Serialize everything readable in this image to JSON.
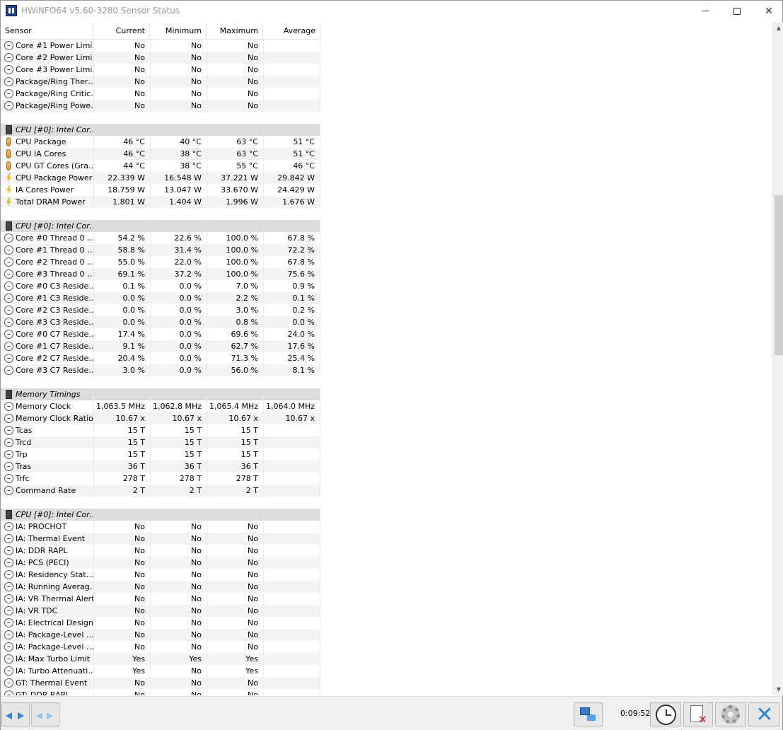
{
  "window": {
    "title": "HWiNFO64 v5.60-3280 Sensor Status"
  },
  "columns": {
    "sensor": "Sensor",
    "current": "Current",
    "minimum": "Minimum",
    "maximum": "Maximum",
    "average": "Average"
  },
  "rows": [
    {
      "type": "item",
      "icon": "clock-icon",
      "name": "Core #1 Power Limi…",
      "cur": "No",
      "min": "No",
      "max": "No",
      "avg": ""
    },
    {
      "type": "item",
      "icon": "clock-icon",
      "name": "Core #2 Power Limi…",
      "cur": "No",
      "min": "No",
      "max": "No",
      "avg": ""
    },
    {
      "type": "item",
      "icon": "clock-icon",
      "name": "Core #3 Power Limi…",
      "cur": "No",
      "min": "No",
      "max": "No",
      "avg": ""
    },
    {
      "type": "item",
      "icon": "clock-icon",
      "name": "Package/Ring Ther…",
      "cur": "No",
      "min": "No",
      "max": "No",
      "avg": ""
    },
    {
      "type": "item",
      "icon": "clock-icon",
      "name": "Package/Ring Critic…",
      "cur": "No",
      "min": "No",
      "max": "No",
      "avg": ""
    },
    {
      "type": "item",
      "icon": "clock-icon",
      "name": "Package/Ring Powe…",
      "cur": "No",
      "min": "No",
      "max": "No",
      "avg": ""
    },
    {
      "type": "blank"
    },
    {
      "type": "group",
      "icon": "chip-icon",
      "name": "CPU [#0]: Intel Cor…"
    },
    {
      "type": "item",
      "icon": "thermometer-icon",
      "name": "CPU Package",
      "cur": "46 °C",
      "min": "40 °C",
      "max": "63 °C",
      "avg": "51 °C"
    },
    {
      "type": "item",
      "icon": "thermometer-icon",
      "name": "CPU IA Cores",
      "cur": "46 °C",
      "min": "38 °C",
      "max": "63 °C",
      "avg": "51 °C"
    },
    {
      "type": "item",
      "icon": "thermometer-icon",
      "name": "CPU GT Cores (Gra…",
      "cur": "44 °C",
      "min": "38 °C",
      "max": "55 °C",
      "avg": "46 °C"
    },
    {
      "type": "item",
      "icon": "lightning-icon",
      "name": "CPU Package Power",
      "cur": "22.339 W",
      "min": "16.548 W",
      "max": "37.221 W",
      "avg": "29.842 W"
    },
    {
      "type": "item",
      "icon": "lightning-icon",
      "name": "IA Cores Power",
      "cur": "18.759 W",
      "min": "13.047 W",
      "max": "33.670 W",
      "avg": "24.429 W"
    },
    {
      "type": "item",
      "icon": "lightning-icon",
      "name": "Total DRAM Power",
      "cur": "1.801 W",
      "min": "1.404 W",
      "max": "1.996 W",
      "avg": "1.676 W"
    },
    {
      "type": "blank"
    },
    {
      "type": "group",
      "icon": "chip-icon",
      "name": "CPU [#0]: Intel Cor…"
    },
    {
      "type": "item",
      "icon": "clock-icon",
      "name": "Core #0 Thread 0 …",
      "cur": "54.2 %",
      "min": "22.6 %",
      "max": "100.0 %",
      "avg": "67.8 %"
    },
    {
      "type": "item",
      "icon": "clock-icon",
      "name": "Core #1 Thread 0 …",
      "cur": "58.8 %",
      "min": "31.4 %",
      "max": "100.0 %",
      "avg": "72.2 %"
    },
    {
      "type": "item",
      "icon": "clock-icon",
      "name": "Core #2 Thread 0 …",
      "cur": "55.0 %",
      "min": "22.0 %",
      "max": "100.0 %",
      "avg": "67.8 %"
    },
    {
      "type": "item",
      "icon": "clock-icon",
      "name": "Core #3 Thread 0 …",
      "cur": "69.1 %",
      "min": "37.2 %",
      "max": "100.0 %",
      "avg": "75.6 %"
    },
    {
      "type": "item",
      "icon": "clock-icon",
      "name": "Core #0 C3 Reside…",
      "cur": "0.1 %",
      "min": "0.0 %",
      "max": "7.0 %",
      "avg": "0.9 %"
    },
    {
      "type": "item",
      "icon": "clock-icon",
      "name": "Core #1 C3 Reside…",
      "cur": "0.0 %",
      "min": "0.0 %",
      "max": "2.2 %",
      "avg": "0.1 %"
    },
    {
      "type": "item",
      "icon": "clock-icon",
      "name": "Core #2 C3 Reside…",
      "cur": "0.0 %",
      "min": "0.0 %",
      "max": "3.0 %",
      "avg": "0.2 %"
    },
    {
      "type": "item",
      "icon": "clock-icon",
      "name": "Core #3 C3 Reside…",
      "cur": "0.0 %",
      "min": "0.0 %",
      "max": "0.8 %",
      "avg": "0.0 %"
    },
    {
      "type": "item",
      "icon": "clock-icon",
      "name": "Core #0 C7 Reside…",
      "cur": "17.4 %",
      "min": "0.0 %",
      "max": "69.6 %",
      "avg": "24.0 %"
    },
    {
      "type": "item",
      "icon": "clock-icon",
      "name": "Core #1 C7 Reside…",
      "cur": "9.1 %",
      "min": "0.0 %",
      "max": "62.7 %",
      "avg": "17.6 %"
    },
    {
      "type": "item",
      "icon": "clock-icon",
      "name": "Core #2 C7 Reside…",
      "cur": "20.4 %",
      "min": "0.0 %",
      "max": "71.3 %",
      "avg": "25.4 %"
    },
    {
      "type": "item",
      "icon": "clock-icon",
      "name": "Core #3 C7 Reside…",
      "cur": "3.0 %",
      "min": "0.0 %",
      "max": "56.0 %",
      "avg": "8.1 %"
    },
    {
      "type": "blank"
    },
    {
      "type": "group",
      "icon": "chip-icon",
      "name": "Memory Timings"
    },
    {
      "type": "item",
      "icon": "clock-icon",
      "name": "Memory Clock",
      "cur": "1,063.5 MHz",
      "min": "1,062.8 MHz",
      "max": "1,065.4 MHz",
      "avg": "1,064.0 MHz"
    },
    {
      "type": "item",
      "icon": "clock-icon",
      "name": "Memory Clock Ratio",
      "cur": "10.67 x",
      "min": "10.67 x",
      "max": "10.67 x",
      "avg": "10.67 x"
    },
    {
      "type": "item",
      "icon": "clock-icon",
      "name": "Tcas",
      "cur": "15 T",
      "min": "15 T",
      "max": "15 T",
      "avg": ""
    },
    {
      "type": "item",
      "icon": "clock-icon",
      "name": "Trcd",
      "cur": "15 T",
      "min": "15 T",
      "max": "15 T",
      "avg": ""
    },
    {
      "type": "item",
      "icon": "clock-icon",
      "name": "Trp",
      "cur": "15 T",
      "min": "15 T",
      "max": "15 T",
      "avg": ""
    },
    {
      "type": "item",
      "icon": "clock-icon",
      "name": "Tras",
      "cur": "36 T",
      "min": "36 T",
      "max": "36 T",
      "avg": ""
    },
    {
      "type": "item",
      "icon": "clock-icon",
      "name": "Trfc",
      "cur": "278 T",
      "min": "278 T",
      "max": "278 T",
      "avg": ""
    },
    {
      "type": "item",
      "icon": "clock-icon",
      "name": "Command Rate",
      "cur": "2 T",
      "min": "2 T",
      "max": "2 T",
      "avg": ""
    },
    {
      "type": "blank"
    },
    {
      "type": "group",
      "icon": "chip-icon",
      "name": "CPU [#0]: Intel Cor…"
    },
    {
      "type": "item",
      "icon": "clock-icon",
      "name": "IA: PROCHOT",
      "cur": "No",
      "min": "No",
      "max": "No",
      "avg": ""
    },
    {
      "type": "item",
      "icon": "clock-icon",
      "name": "IA: Thermal Event",
      "cur": "No",
      "min": "No",
      "max": "No",
      "avg": ""
    },
    {
      "type": "item",
      "icon": "clock-icon",
      "name": "IA: DDR RAPL",
      "cur": "No",
      "min": "No",
      "max": "No",
      "avg": ""
    },
    {
      "type": "item",
      "icon": "clock-icon",
      "name": "IA: PCS (PECI)",
      "cur": "No",
      "min": "No",
      "max": "No",
      "avg": ""
    },
    {
      "type": "item",
      "icon": "clock-icon",
      "name": "IA: Residency Stat…",
      "cur": "No",
      "min": "No",
      "max": "No",
      "avg": ""
    },
    {
      "type": "item",
      "icon": "clock-icon",
      "name": "IA: Running Averag…",
      "cur": "No",
      "min": "No",
      "max": "No",
      "avg": ""
    },
    {
      "type": "item",
      "icon": "clock-icon",
      "name": "IA: VR Thermal Alert",
      "cur": "No",
      "min": "No",
      "max": "No",
      "avg": ""
    },
    {
      "type": "item",
      "icon": "clock-icon",
      "name": "IA: VR TDC",
      "cur": "No",
      "min": "No",
      "max": "No",
      "avg": ""
    },
    {
      "type": "item",
      "icon": "clock-icon",
      "name": "IA: Electrical Design…",
      "cur": "No",
      "min": "No",
      "max": "No",
      "avg": ""
    },
    {
      "type": "item",
      "icon": "clock-icon",
      "name": "IA: Package-Level …",
      "cur": "No",
      "min": "No",
      "max": "No",
      "avg": ""
    },
    {
      "type": "item",
      "icon": "clock-icon",
      "name": "IA: Package-Level …",
      "cur": "No",
      "min": "No",
      "max": "No",
      "avg": ""
    },
    {
      "type": "item",
      "icon": "clock-icon",
      "name": "IA: Max Turbo Limit",
      "cur": "Yes",
      "min": "Yes",
      "max": "Yes",
      "avg": ""
    },
    {
      "type": "item",
      "icon": "clock-icon",
      "name": "IA: Turbo Attenuati…",
      "cur": "Yes",
      "min": "No",
      "max": "Yes",
      "avg": ""
    },
    {
      "type": "item",
      "icon": "clock-icon",
      "name": "GT: Thermal Event",
      "cur": "No",
      "min": "No",
      "max": "No",
      "avg": ""
    },
    {
      "type": "item",
      "icon": "clock-icon",
      "name": "GT: DDR RAPL",
      "cur": "No",
      "min": "No",
      "max": "No",
      "avg": ""
    }
  ],
  "status": {
    "elapsed": "0:09:52"
  },
  "icons": {
    "nav_left": "arrow-left-icon",
    "nav_right": "arrow-right-icon",
    "network": "network-icon",
    "clock": "clock-icon",
    "log": "log-file-icon",
    "settings": "gear-icon",
    "close": "close-icon"
  },
  "colors": {
    "accent": "#2f86d6",
    "group_row": "#dcdcdc",
    "alt_row": "#f4f4f4",
    "title_text": "#9b9b9b"
  }
}
